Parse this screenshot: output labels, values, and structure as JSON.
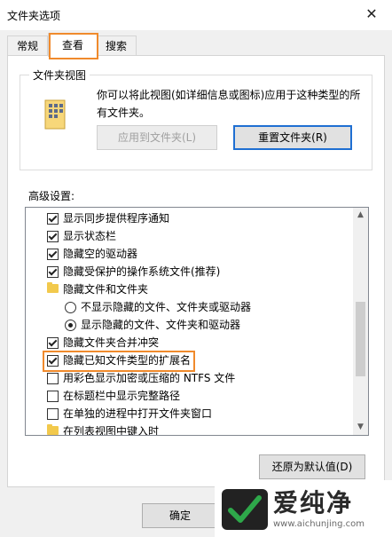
{
  "window": {
    "title": "文件夹选项",
    "close_glyph": "✕"
  },
  "tabs": [
    {
      "label": "常规"
    },
    {
      "label": "查看",
      "active": true
    },
    {
      "label": "搜索"
    }
  ],
  "folder_view": {
    "legend": "文件夹视图",
    "description": "你可以将此视图(如详细信息或图标)应用于这种类型的所有文件夹。",
    "apply_button": "应用到文件夹(L)",
    "reset_button": "重置文件夹(R)"
  },
  "advanced": {
    "label": "高级设置:",
    "items": [
      {
        "type": "checkbox",
        "checked": true,
        "label": "显示同步提供程序通知"
      },
      {
        "type": "checkbox",
        "checked": true,
        "label": "显示状态栏"
      },
      {
        "type": "checkbox",
        "checked": true,
        "label": "隐藏空的驱动器"
      },
      {
        "type": "checkbox",
        "checked": true,
        "label": "隐藏受保护的操作系统文件(推荐)"
      },
      {
        "type": "folder",
        "label": "隐藏文件和文件夹"
      },
      {
        "type": "radio",
        "checked": false,
        "label": "不显示隐藏的文件、文件夹或驱动器"
      },
      {
        "type": "radio",
        "checked": true,
        "label": "显示隐藏的文件、文件夹和驱动器"
      },
      {
        "type": "checkbox",
        "checked": true,
        "label": "隐藏文件夹合并冲突"
      },
      {
        "type": "checkbox",
        "checked": true,
        "label": "隐藏已知文件类型的扩展名"
      },
      {
        "type": "checkbox",
        "checked": false,
        "label": "用彩色显示加密或压缩的 NTFS 文件"
      },
      {
        "type": "checkbox",
        "checked": false,
        "label": "在标题栏中显示完整路径"
      },
      {
        "type": "checkbox",
        "checked": false,
        "label": "在单独的进程中打开文件夹窗口"
      },
      {
        "type": "folder",
        "label": "在列表视图中键入时"
      }
    ]
  },
  "restore_button": "还原为默认值(D)",
  "ok_button": "确定",
  "watermark": {
    "title": "爱纯净",
    "url": "www.aichunjing.com"
  },
  "colors": {
    "highlight": "#f08a2c",
    "focus_border": "#1f6fd2",
    "watermark_green": "#2ea84a"
  }
}
